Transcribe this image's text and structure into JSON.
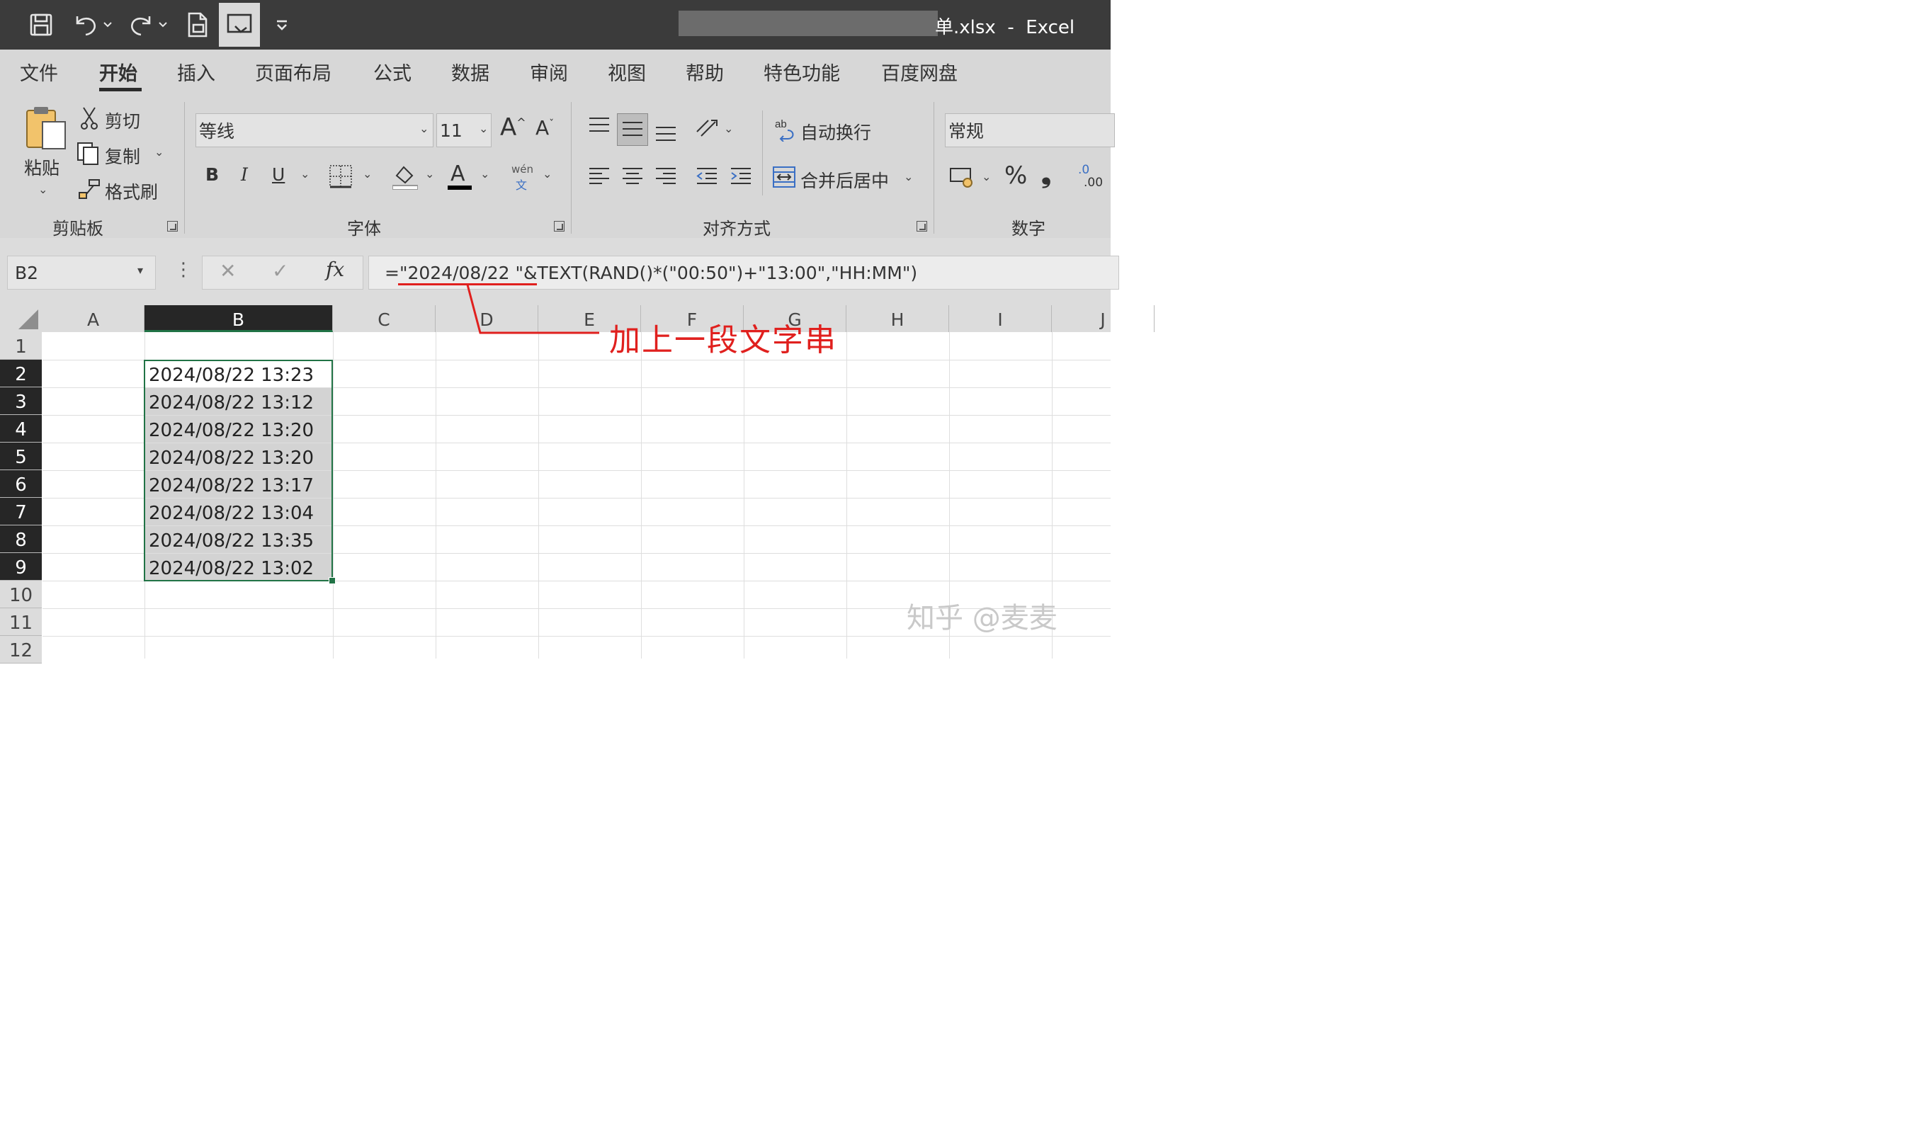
{
  "window": {
    "title": "单.xlsx  -  Excel"
  },
  "ribbon_tabs": [
    "文件",
    "开始",
    "插入",
    "页面布局",
    "公式",
    "数据",
    "审阅",
    "视图",
    "帮助",
    "特色功能",
    "百度网盘"
  ],
  "active_tab": "开始",
  "clipboard": {
    "paste": "粘贴",
    "cut": "剪切",
    "copy": "复制",
    "format_painter": "格式刷",
    "group_label": "剪贴板"
  },
  "font": {
    "name": "等线",
    "size": "11",
    "bold": "B",
    "italic": "I",
    "underline": "U",
    "font_color_letter": "A",
    "phonetic_top": "wén",
    "phonetic_bottom": "文",
    "group_label": "字体",
    "font_color": "#000000"
  },
  "alignment": {
    "wrap_text": "自动换行",
    "merge_center": "合并后居中",
    "group_label": "对齐方式"
  },
  "number": {
    "format": "常规",
    "percent": "%",
    "comma": "❟",
    "decimal_top": ".0",
    "decimal_bottom": ".00",
    "group_label": "数字"
  },
  "formula_bar": {
    "name_box": "B2",
    "fx": "fx",
    "formula": "=\"2024/08/22 \"&TEXT(RAND()*(\"00:50\")+\"13:00\",\"HH:MM\")"
  },
  "sheet": {
    "columns": [
      "A",
      "B",
      "C",
      "D",
      "E",
      "F",
      "G",
      "H",
      "I",
      "J"
    ],
    "rows": [
      "1",
      "2",
      "3",
      "4",
      "5",
      "6",
      "7",
      "8",
      "9",
      "10",
      "11",
      "12"
    ],
    "b_values": [
      "2024/08/22 13:23",
      "2024/08/22 13:12",
      "2024/08/22 13:20",
      "2024/08/22 13:20",
      "2024/08/22 13:17",
      "2024/08/22 13:04",
      "2024/08/22 13:35",
      "2024/08/22 13:02"
    ],
    "selected_column": "B"
  },
  "annotation": {
    "text": "加上一段文字串",
    "color": "#e0201e"
  },
  "watermark": "知乎 @麦麦",
  "colors": {
    "accent": "#217346",
    "titlebar": "#3b3b3b"
  }
}
